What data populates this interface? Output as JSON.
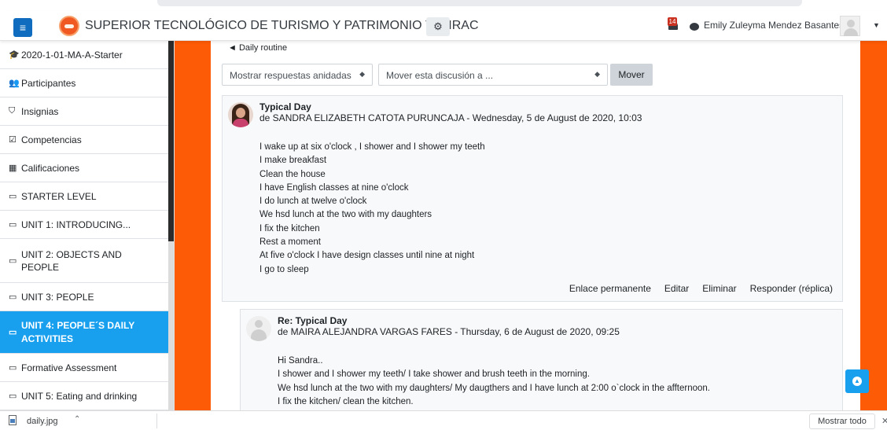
{
  "navbar": {
    "site_name": "SUPERIOR TECNOLÓGICO DE TURISMO Y PATRIMONIO YAVIRAC",
    "notification_count": "14",
    "user_name": "Emily Zuleyma Mendez Basantes",
    "icons": {
      "menu": "hamburger-icon",
      "logo": "institution-logo",
      "gear": "gears-icon",
      "bell": "bell-icon",
      "message": "chat-bubble-icon",
      "caret": "caret-down-icon"
    }
  },
  "sidebar": {
    "items": [
      {
        "label": "2020-1-01-MA-A-Starter",
        "icon": "graduation-cap-icon",
        "glyph": "🎓",
        "active": false
      },
      {
        "label": "Participantes",
        "icon": "users-icon",
        "glyph": "👥",
        "active": false
      },
      {
        "label": "Insignias",
        "icon": "shield-icon",
        "glyph": "⛉",
        "active": false
      },
      {
        "label": "Competencias",
        "icon": "check-square-icon",
        "glyph": "☑",
        "active": false
      },
      {
        "label": "Calificaciones",
        "icon": "table-icon",
        "glyph": "▦",
        "active": false
      },
      {
        "label": "STARTER LEVEL",
        "icon": "folder-icon",
        "glyph": "▭",
        "active": false
      },
      {
        "label": "UNIT 1: INTRODUCING...",
        "icon": "folder-icon",
        "glyph": "▭",
        "active": false
      },
      {
        "label": "UNIT 2: OBJECTS AND PEOPLE",
        "icon": "folder-icon",
        "glyph": "▭",
        "active": false
      },
      {
        "label": "UNIT 3: PEOPLE",
        "icon": "folder-icon",
        "glyph": "▭",
        "active": false
      },
      {
        "label": "UNIT 4: PEOPLE´S DAILY ACTIVITIES",
        "icon": "folder-icon",
        "glyph": "▭",
        "active": true
      },
      {
        "label": "Formative Assessment",
        "icon": "folder-icon",
        "glyph": "▭",
        "active": false
      },
      {
        "label": "UNIT 5: Eating and drinking",
        "icon": "folder-icon",
        "glyph": "▭",
        "active": false
      }
    ]
  },
  "main": {
    "prev_link": "◄ Daily routine",
    "display_select": "Mostrar respuestas anidadas",
    "move_select": "Mover esta discusión a ...",
    "move_button": "Mover",
    "posts": [
      {
        "title": "Typical Day",
        "byline": "de SANDRA ELIZABETH CATOTA PURUNCAJA - Wednesday, 5 de August de 2020, 10:03",
        "lines": [
          "I wake up at six o'clock , I shower and I shower my teeth",
          "I make breakfast",
          "Clean the house",
          "I have English classes at nine o'clock",
          "I do lunch at twelve o'clock",
          "We hsd lunch at the two with my daughters",
          "I fix the kitchen",
          "Rest a moment",
          "At five o'clock I have design classes until nine at night",
          "I go to sleep"
        ],
        "actions": [
          "Enlace permanente",
          "Editar",
          "Eliminar",
          "Responder (réplica)"
        ]
      },
      {
        "title": "Re: Typical Day",
        "byline": "de MAIRA ALEJANDRA VARGAS FARES - Thursday, 6 de August de 2020, 09:25",
        "lines": [
          "Hi Sandra..",
          "I shower and I shower my teeth/ I take shower and brush teeth in the morning.",
          "We hsd lunch at the two with my daughters/ My daugthers and I have lunch at 2:00 o`clock in the affternoon.",
          "I fix the kitchen/ clean the kitchen."
        ]
      }
    ]
  },
  "downloads": {
    "file_name": "daily.jpg",
    "show_all": "Mostrar todo"
  },
  "colors": {
    "brand_blue": "#0f6cbf",
    "active_blue": "#18a0ef",
    "frame_orange": "#fe5b06"
  }
}
